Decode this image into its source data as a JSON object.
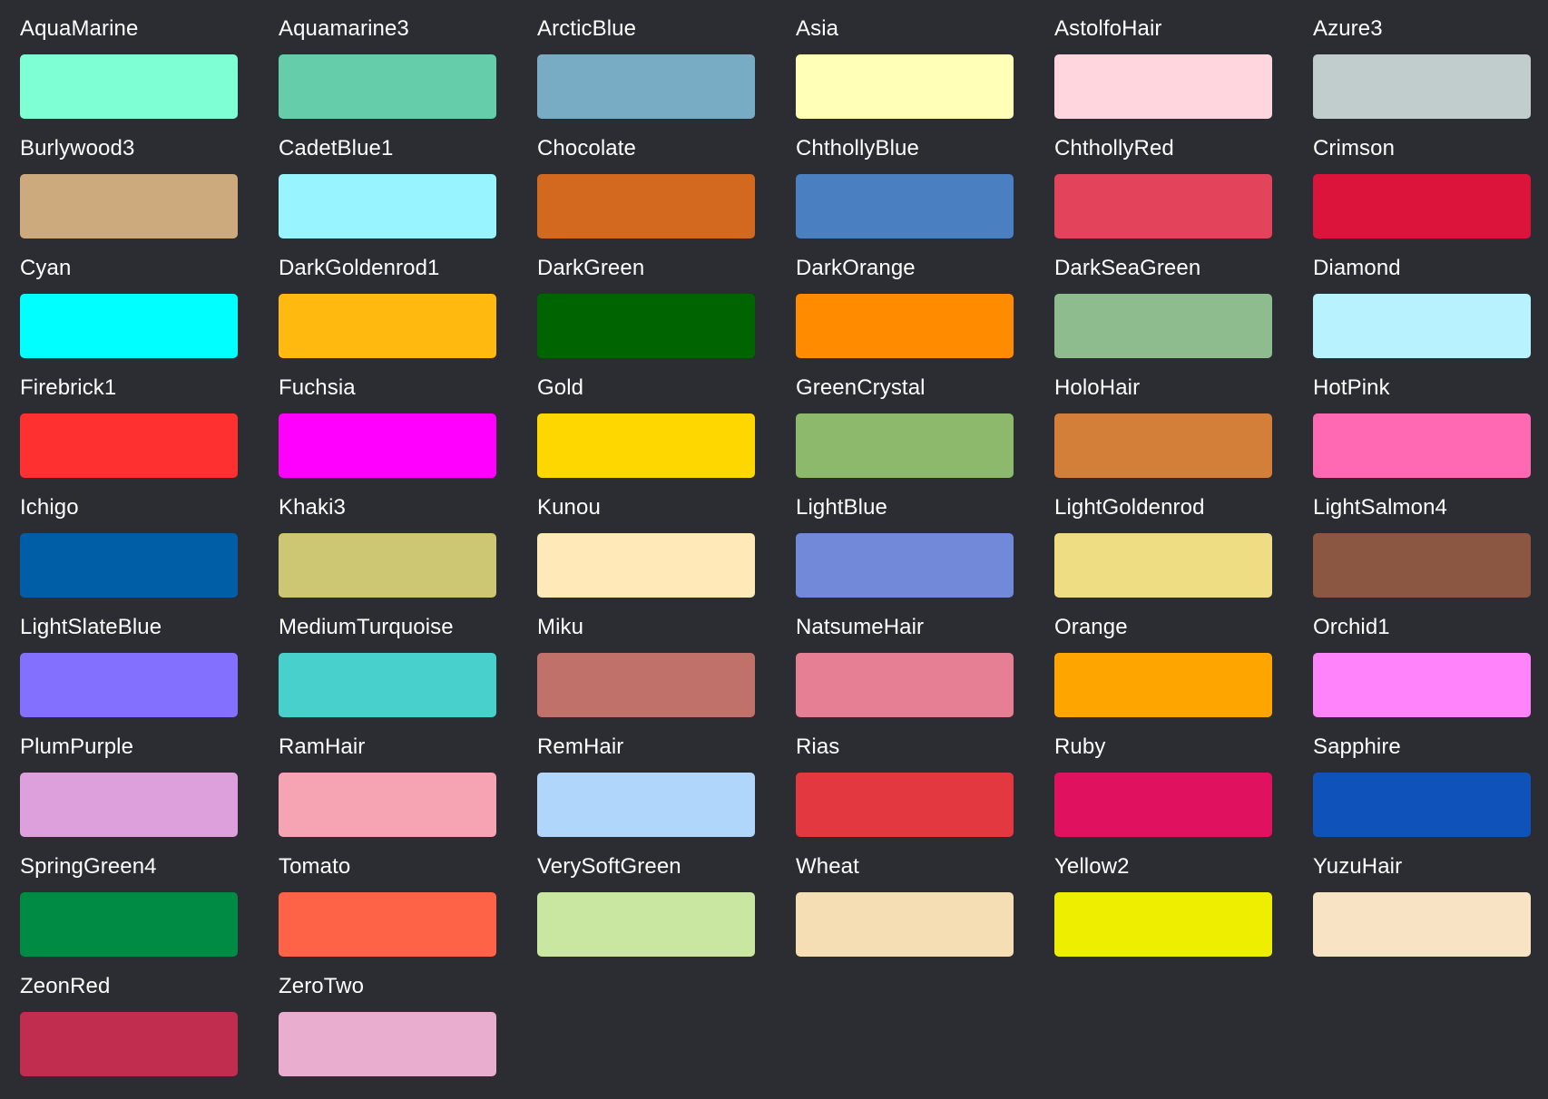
{
  "colors": [
    {
      "name": "AquaMarine",
      "hex": "#7fffd4"
    },
    {
      "name": "Aquamarine3",
      "hex": "#66cdaa"
    },
    {
      "name": "ArcticBlue",
      "hex": "#78acc4"
    },
    {
      "name": "Asia",
      "hex": "#ffffb8"
    },
    {
      "name": "AstolfoHair",
      "hex": "#ffd6de"
    },
    {
      "name": "Azure3",
      "hex": "#c1cdcd"
    },
    {
      "name": "Burlywood3",
      "hex": "#cdaa7d"
    },
    {
      "name": "CadetBlue1",
      "hex": "#98f5ff"
    },
    {
      "name": "Chocolate",
      "hex": "#d2691e"
    },
    {
      "name": "ChthollyBlue",
      "hex": "#4a80c2"
    },
    {
      "name": "ChthollyRed",
      "hex": "#e3445c"
    },
    {
      "name": "Crimson",
      "hex": "#dc143c"
    },
    {
      "name": "Cyan",
      "hex": "#00ffff"
    },
    {
      "name": "DarkGoldenrod1",
      "hex": "#ffb90f"
    },
    {
      "name": "DarkGreen",
      "hex": "#006400"
    },
    {
      "name": "DarkOrange",
      "hex": "#ff8c00"
    },
    {
      "name": "DarkSeaGreen",
      "hex": "#8fbc8f"
    },
    {
      "name": "Diamond",
      "hex": "#b9f2ff"
    },
    {
      "name": "Firebrick1",
      "hex": "#ff3030"
    },
    {
      "name": "Fuchsia",
      "hex": "#ff00ff"
    },
    {
      "name": "Gold",
      "hex": "#ffd700"
    },
    {
      "name": "GreenCrystal",
      "hex": "#8db96c"
    },
    {
      "name": "HoloHair",
      "hex": "#d37e39"
    },
    {
      "name": "HotPink",
      "hex": "#ff69b4"
    },
    {
      "name": "Ichigo",
      "hex": "#005ea6"
    },
    {
      "name": "Khaki3",
      "hex": "#cdc673"
    },
    {
      "name": "Kunou",
      "hex": "#ffe9b9"
    },
    {
      "name": "LightBlue",
      "hex": "#7289da"
    },
    {
      "name": "LightGoldenrod",
      "hex": "#eedd82"
    },
    {
      "name": "LightSalmon4",
      "hex": "#8b5742"
    },
    {
      "name": "LightSlateBlue",
      "hex": "#8470ff"
    },
    {
      "name": "MediumTurquoise",
      "hex": "#48d1cc"
    },
    {
      "name": "Miku",
      "hex": "#c07169"
    },
    {
      "name": "NatsumeHair",
      "hex": "#e67e94"
    },
    {
      "name": "Orange",
      "hex": "#ffa500"
    },
    {
      "name": "Orchid1",
      "hex": "#ff83fa"
    },
    {
      "name": "PlumPurple",
      "hex": "#dda0dd"
    },
    {
      "name": "RamHair",
      "hex": "#f6a4b4"
    },
    {
      "name": "RemHair",
      "hex": "#b0d6fb"
    },
    {
      "name": "Rias",
      "hex": "#e33840"
    },
    {
      "name": "Ruby",
      "hex": "#e0115f"
    },
    {
      "name": "Sapphire",
      "hex": "#0f52ba"
    },
    {
      "name": "SpringGreen4",
      "hex": "#008b45"
    },
    {
      "name": "Tomato",
      "hex": "#ff6347"
    },
    {
      "name": "VerySoftGreen",
      "hex": "#c9e7a1"
    },
    {
      "name": "Wheat",
      "hex": "#f5deb3"
    },
    {
      "name": "Yellow2",
      "hex": "#eeee00"
    },
    {
      "name": "YuzuHair",
      "hex": "#f8e3c4"
    },
    {
      "name": "ZeonRed",
      "hex": "#c12d4e"
    },
    {
      "name": "ZeroTwo",
      "hex": "#e9aecf"
    }
  ]
}
